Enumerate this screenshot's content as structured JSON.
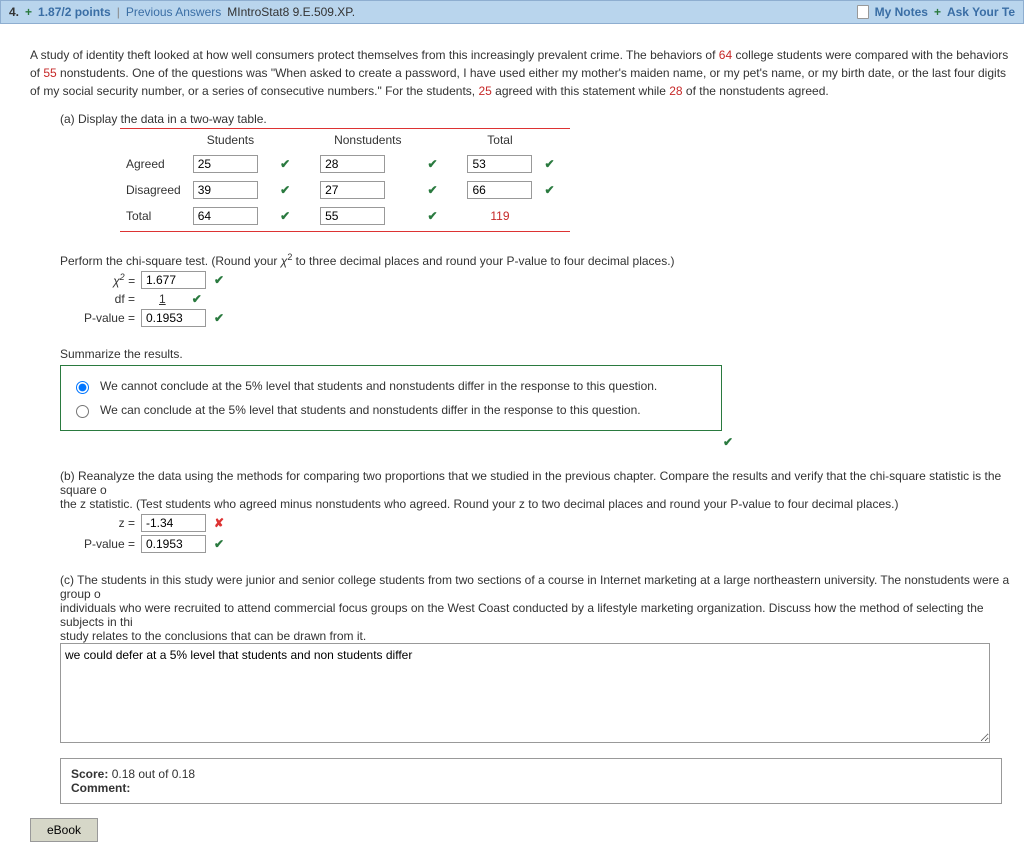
{
  "header": {
    "question_number": "4.",
    "points": "1.87/2 points",
    "prev_answers": "Previous Answers",
    "source": "MIntroStat8 9.E.509.XP.",
    "my_notes": "My Notes",
    "ask": "Ask Your Te"
  },
  "intro": {
    "t1": "A study of identity theft looked at how well consumers protect themselves from this increasingly prevalent crime. The behaviors of ",
    "n64": "64",
    "t2": " college students were compared with the behaviors of ",
    "n55": "55",
    "t3": " nonstudents. One of the questions was \"When asked to create a password, I have used either my mother's maiden name, or my pet's name, or my birth date, or the last four digits of my social security number, or a series of consecutive numbers.\" For the students, ",
    "n25": "25",
    "t4": " agreed with this statement while ",
    "n28": "28",
    "t5": " of the nonstudents agreed."
  },
  "partA": {
    "prompt": "(a) Display the data in a two-way table.",
    "col1": "Students",
    "col2": "Nonstudents",
    "col3": "Total",
    "row1": "Agreed",
    "row2": "Disagreed",
    "row3": "Total",
    "cells": {
      "a1": "25",
      "a2": "28",
      "a3": "53",
      "d1": "39",
      "d2": "27",
      "d3": "66",
      "t1": "64",
      "t2": "55",
      "t3": "119"
    }
  },
  "chi": {
    "prompt_pre": "Perform the chi-square test. (Round your ",
    "chi_symbol": "χ",
    "prompt_post": " to three decimal places and round your P-value to four decimal places.)",
    "chi_label": " = ",
    "chi_val": "1.677",
    "df_label": "df  = ",
    "df_val": "1",
    "pv_label": "P-value  = ",
    "pv_val": "0.1953"
  },
  "summary": {
    "title": "Summarize the results.",
    "opt1": "We cannot conclude at the 5% level that students and nonstudents differ in the response to this question.",
    "opt2": "We can conclude at the 5% level that students and nonstudents differ in the response to this question."
  },
  "partB": {
    "t1": "(b) Reanalyze the data using the methods for comparing two proportions that we studied in the previous chapter. Compare the results and verify that the chi-square statistic is the square o",
    "t2": "the z statistic. (Test students who agreed minus nonstudents who agreed. Round your z to two decimal places and round your P-value to four decimal places.)",
    "z_label": "z = ",
    "z_val": "-1.34",
    "pv_label": "P-value = ",
    "pv_val": "0.1953"
  },
  "partC": {
    "t1": "(c) The students in this study were junior and senior college students from two sections of a course in Internet marketing at a large northeastern university. The nonstudents were a group o",
    "t2": "individuals who were recruited to attend commercial focus groups on the West Coast conducted by a lifestyle marketing organization. Discuss how the method of selecting the subjects in thi",
    "t3": "study relates to the conclusions that can be drawn from it.",
    "answer": "we could defer at a 5% level that students and non students differ"
  },
  "score": {
    "label": "Score:",
    "value": " 0.18 out of 0.18",
    "comment_label": "Comment:"
  },
  "ebook": "eBook"
}
